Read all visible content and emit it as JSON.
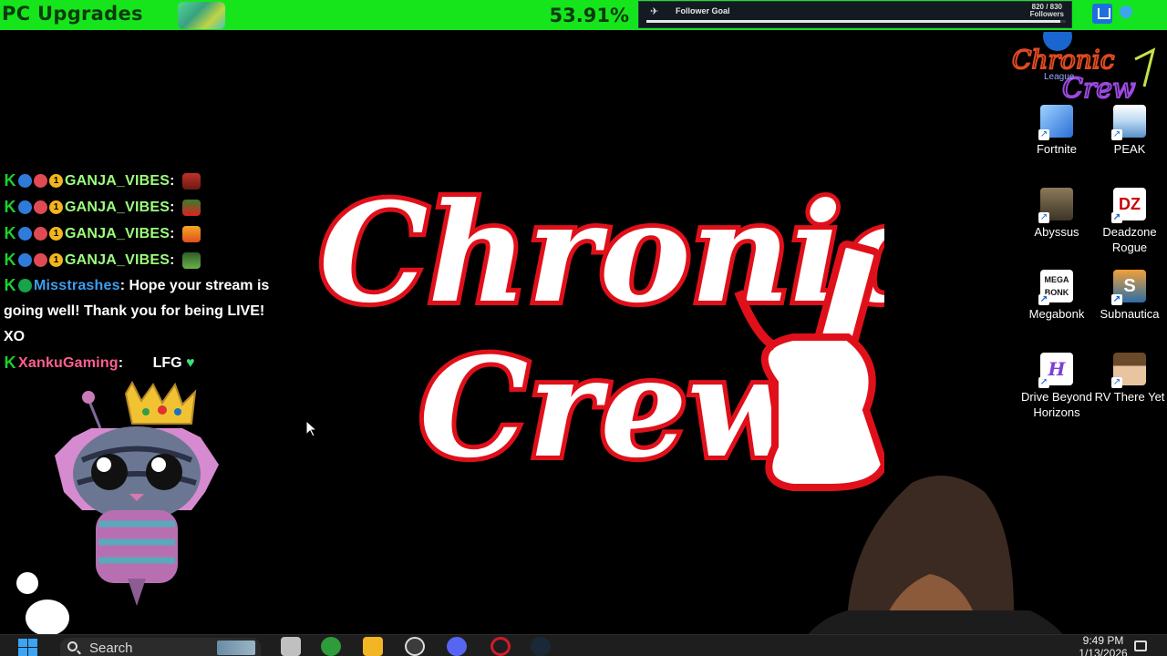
{
  "goal_bar": {
    "title": "PC Upgrades",
    "percent": "53.91%",
    "percent_value": 53.91,
    "bar_color": "#17e51c"
  },
  "follower_goal": {
    "label": "Follower Goal",
    "count": "820 / 830",
    "count_unit": "Followers",
    "progress": 0.988
  },
  "chat": {
    "messages": [
      {
        "user": "GANJA_VIBES",
        "text": ":",
        "emote": "ganja-emote-fire",
        "color": "#9dff7f"
      },
      {
        "user": "GANJA_VIBES",
        "text": ":",
        "emote": "ganja-emote-love",
        "color": "#9dff7f"
      },
      {
        "user": "GANJA_VIBES",
        "text": ":",
        "emote": "ganja-emote-sunset",
        "color": "#9dff7f"
      },
      {
        "user": "GANJA_VIBES",
        "text": ":",
        "emote": "ganja-emote-sticker",
        "color": "#9dff7f"
      },
      {
        "user": "Misstrashes",
        "text": ": Hope your stream is going well! Thank you for being LIVE! XO",
        "color": "#3b9ef0"
      },
      {
        "user": "XankuGaming",
        "text": ":",
        "body": "LFG",
        "emote": "green-heart",
        "color": "#ff5f8f"
      }
    ],
    "badge_og": "OG",
    "badge_one": "1",
    "badge_k": "K"
  },
  "logo": {
    "line1": "Chronic",
    "line2": "Crew",
    "primary_color": "#e0101a"
  },
  "brand_badge": {
    "text1": "Chronic",
    "text2": "Crew",
    "small": "League"
  },
  "desktop_icons": [
    {
      "label": "Fortnite",
      "icon": "fortnite-icon"
    },
    {
      "label": "PEAK",
      "icon": "peak-icon"
    },
    {
      "label": "Abyssus",
      "icon": "abyssus-icon"
    },
    {
      "label": "Deadzone Rogue",
      "icon": "deadzone-icon"
    },
    {
      "label": "Megabonk",
      "icon": "megabonk-icon",
      "tile_text": "MEGA BONK"
    },
    {
      "label": "Subnautica",
      "icon": "subnautica-icon",
      "tile_text": "S"
    },
    {
      "label": "Drive Beyond Horizons",
      "icon": "drive-icon"
    },
    {
      "label": "RV There Yet",
      "icon": "rv-icon"
    }
  ],
  "taskbar": {
    "search_placeholder": "Search",
    "time": "9:49 PM",
    "date": "1/13/2026",
    "apps": [
      "widgets-icon",
      "task-view-icon",
      "xbox-icon",
      "file-explorer-icon",
      "obs-icon",
      "discord-icon",
      "opera-icon",
      "steam-icon"
    ]
  }
}
